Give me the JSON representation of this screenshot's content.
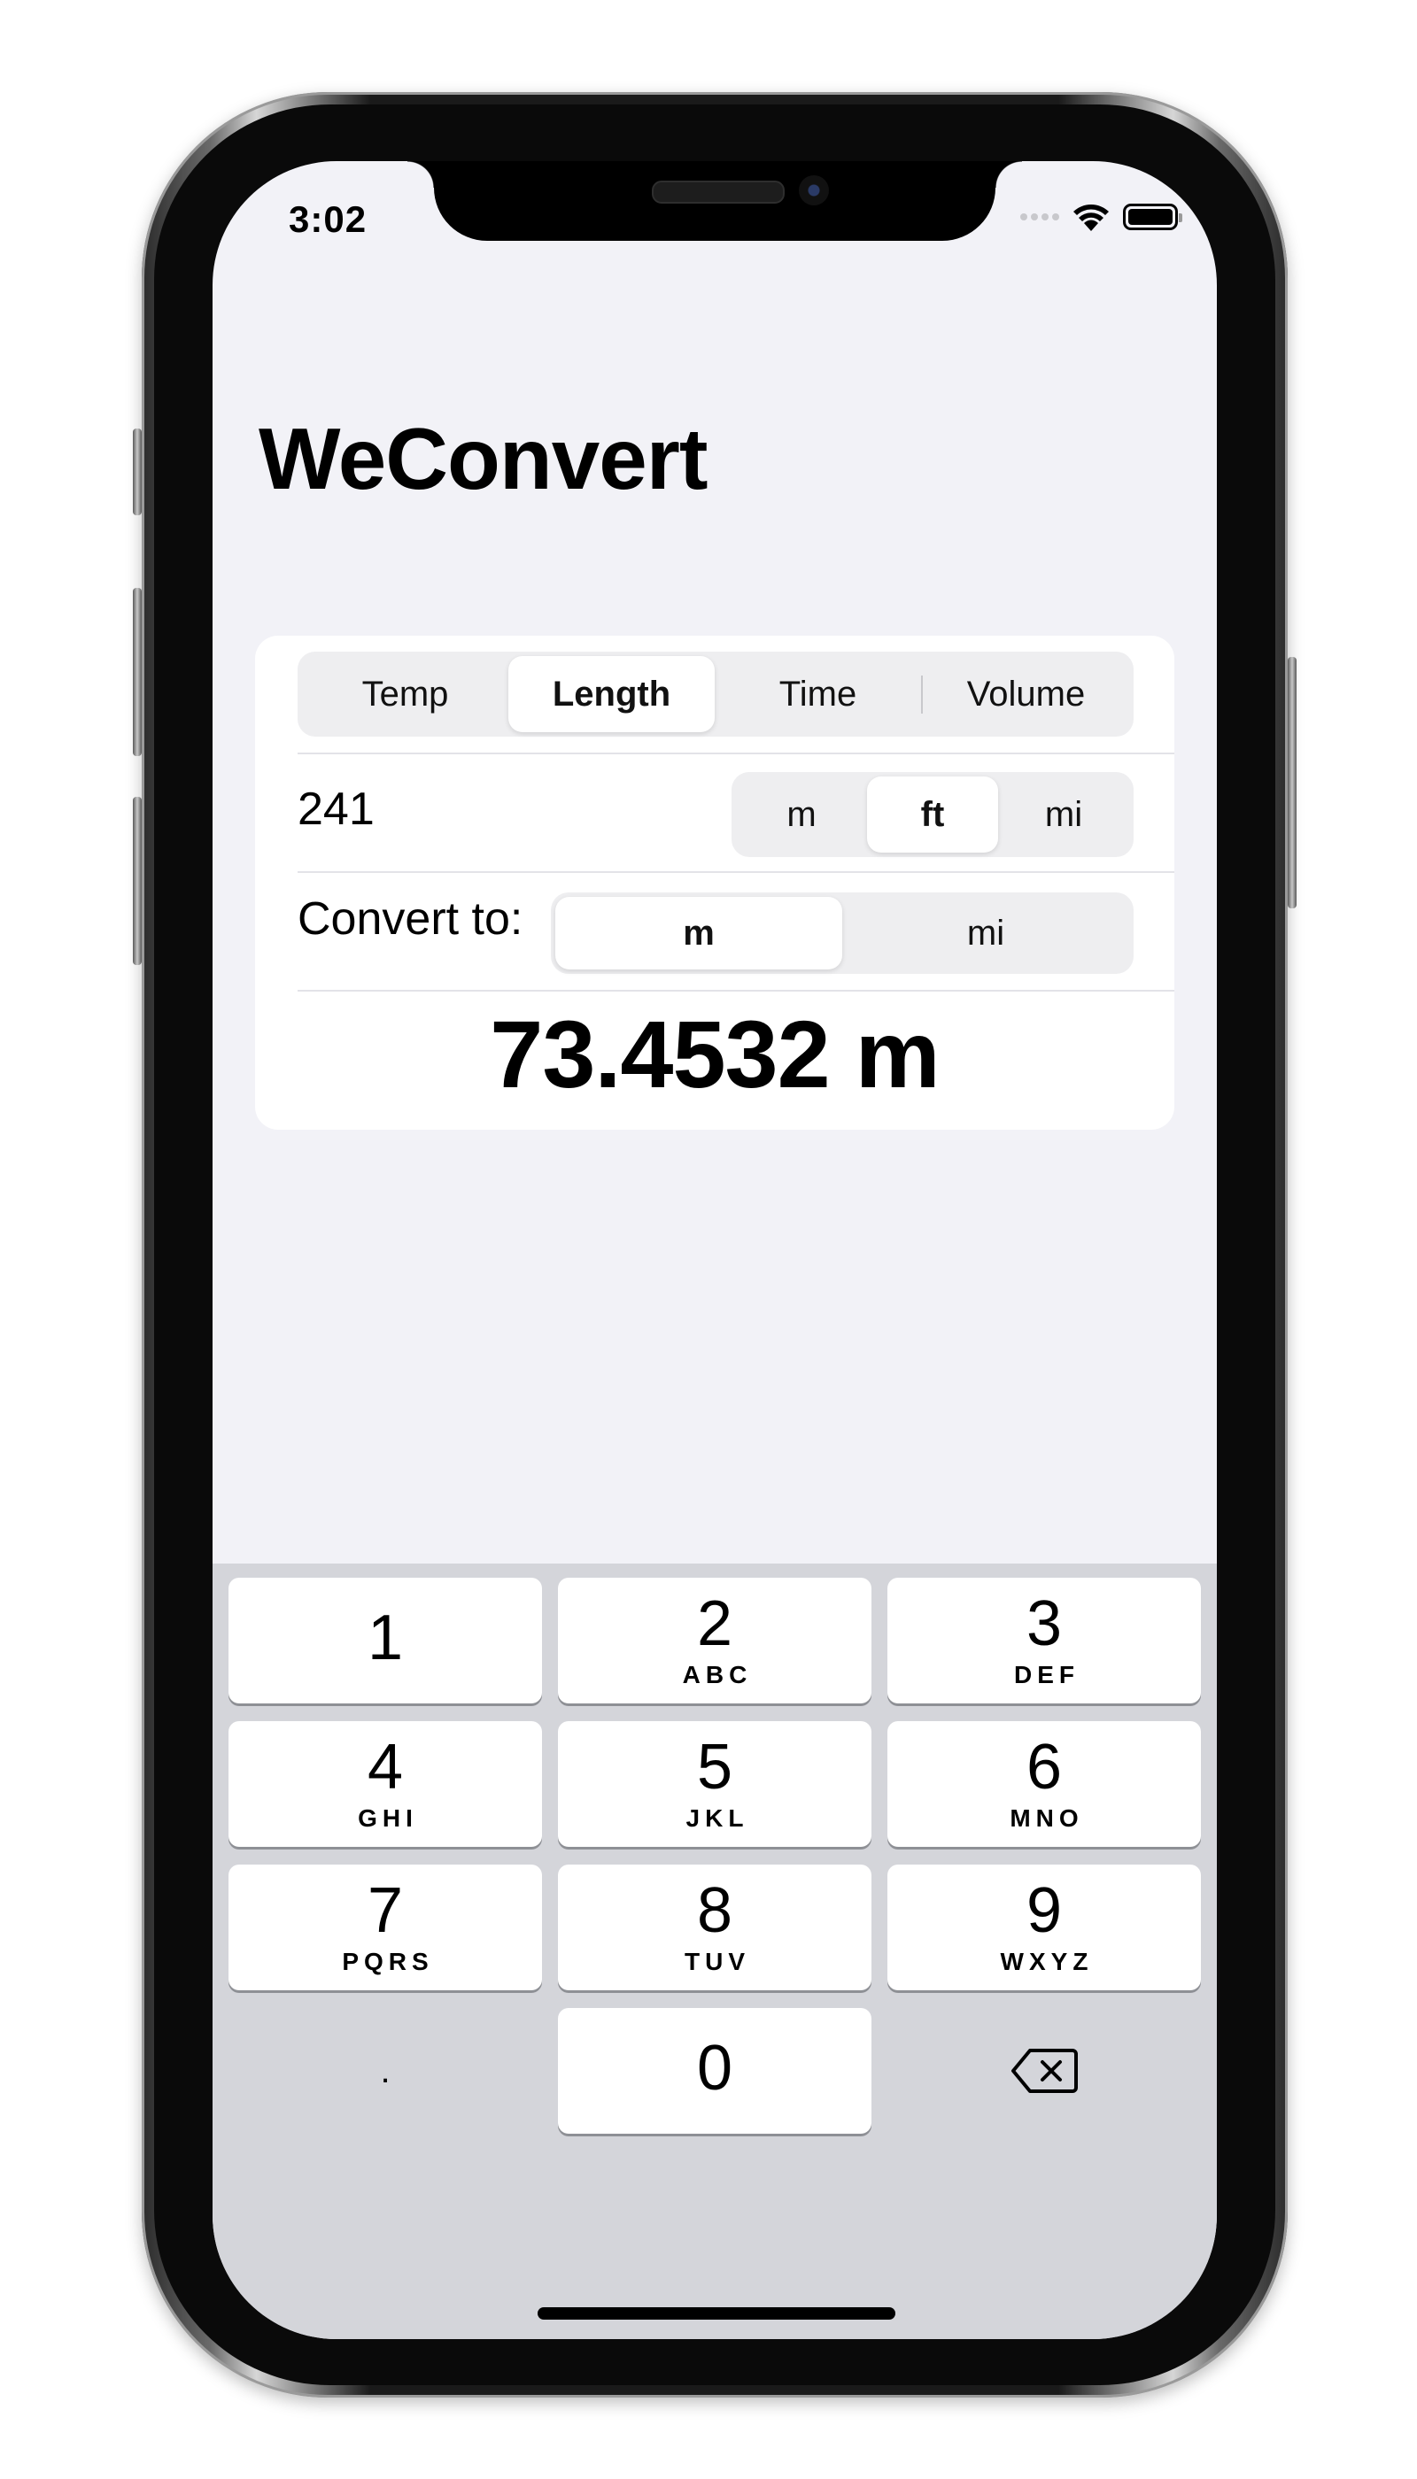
{
  "status_bar": {
    "time": "3:02",
    "icons": [
      "signal-dots-icon",
      "wifi-icon",
      "battery-icon"
    ]
  },
  "app": {
    "title": "WeConvert"
  },
  "category_tabs": {
    "items": [
      "Temp",
      "Length",
      "Time",
      "Volume"
    ],
    "selected": "Length"
  },
  "input_row": {
    "value": "241",
    "units": [
      "m",
      "ft",
      "mi"
    ],
    "selected_unit": "ft"
  },
  "convert_row": {
    "label": "Convert to:",
    "units": [
      "m",
      "mi"
    ],
    "selected_unit": "m"
  },
  "result": {
    "text": "73.4532 m"
  },
  "keyboard": {
    "keys": [
      {
        "digit": "1",
        "letters": ""
      },
      {
        "digit": "2",
        "letters": "ABC"
      },
      {
        "digit": "3",
        "letters": "DEF"
      },
      {
        "digit": "4",
        "letters": "GHI"
      },
      {
        "digit": "5",
        "letters": "JKL"
      },
      {
        "digit": "6",
        "letters": "MNO"
      },
      {
        "digit": "7",
        "letters": "PQRS"
      },
      {
        "digit": "8",
        "letters": "TUV"
      },
      {
        "digit": "9",
        "letters": "WXYZ"
      },
      {
        "digit": "0",
        "letters": ""
      }
    ],
    "decimal_label": ".",
    "delete_icon": "delete-backspace-icon"
  },
  "colors": {
    "background": "#f2f2f7",
    "card": "#ffffff",
    "segment_bg": "#eeeef0",
    "keyboard_bg": "#d4d5da",
    "text": "#000000"
  }
}
